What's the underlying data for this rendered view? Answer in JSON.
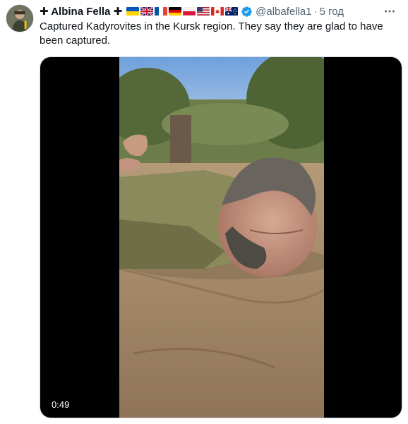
{
  "author": {
    "prefix_symbol": "✚",
    "name": "Albina Fella",
    "suffix_symbol": "✚",
    "handle": "@albafella1",
    "separator": "·",
    "time": "5 год",
    "flags": [
      "ukraine-flag",
      "uk-flag",
      "france-flag",
      "germany-flag",
      "poland-flag",
      "usa-flag",
      "canada-flag",
      "australia-flag"
    ],
    "verified": true
  },
  "tweet": {
    "text": "Captured Kadyrovites in the Kursk region. They say they are glad to have been captured."
  },
  "video": {
    "duration": "0:49"
  },
  "colors": {
    "text": "#0f1419",
    "secondary": "#536471",
    "verified_blue": "#1d9bf0"
  }
}
